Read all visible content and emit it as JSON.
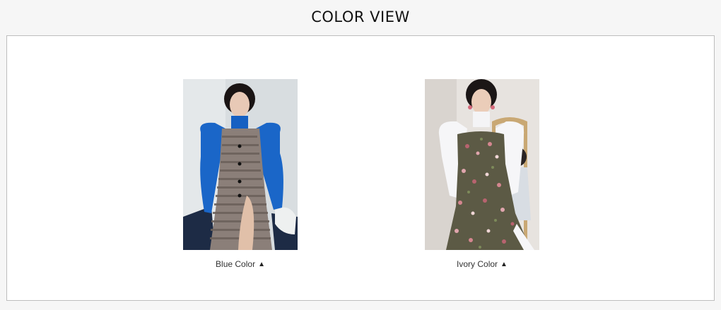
{
  "header": {
    "title": "COLOR VIEW"
  },
  "colors": [
    {
      "label": "Blue Color",
      "arrow": "▲",
      "image_description": "model-in-blue-top-and-houndstooth-dress"
    },
    {
      "label": "Ivory Color",
      "arrow": "▲",
      "image_description": "model-in-ivory-blouse-and-floral-dress"
    }
  ],
  "theme": {
    "frame_border": "#bdbdbd",
    "background": "#f6f6f6",
    "text": "#333333"
  }
}
